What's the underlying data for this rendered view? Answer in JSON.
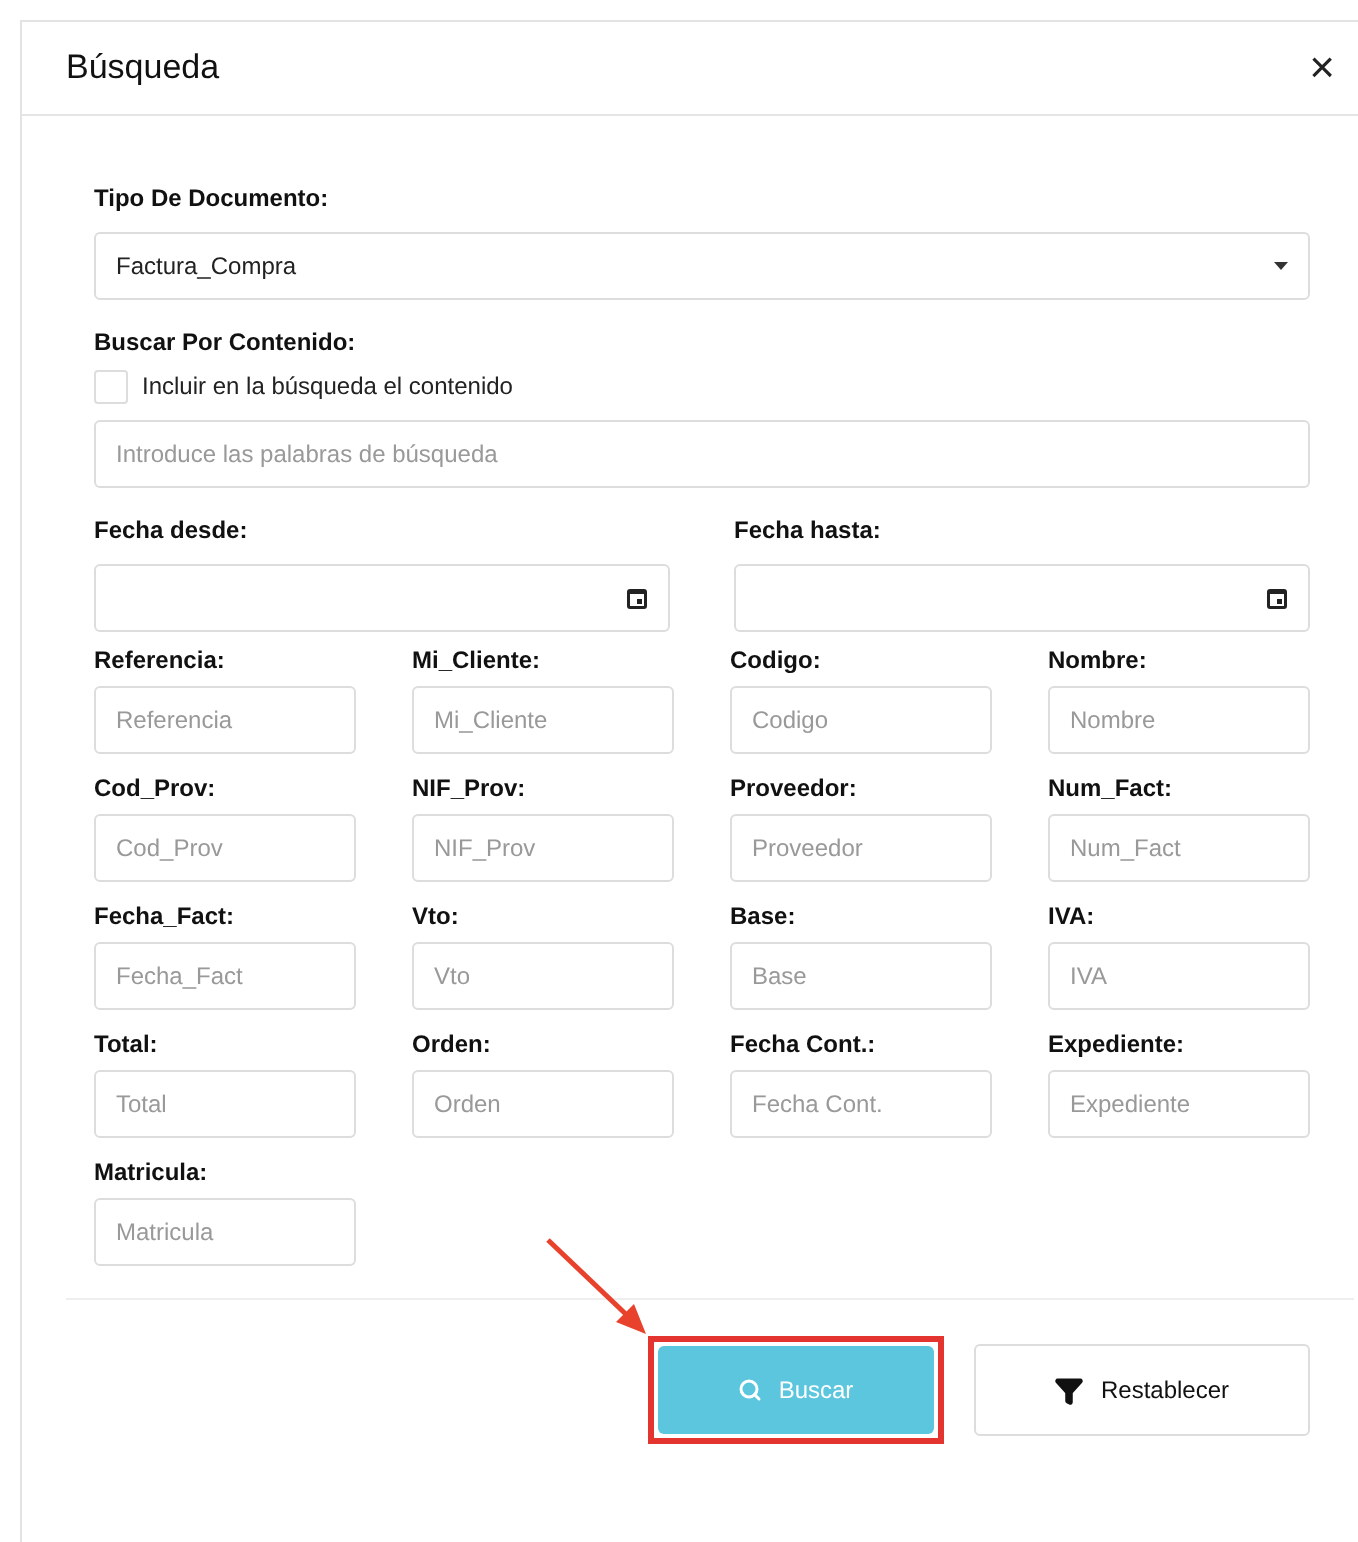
{
  "dialog": {
    "title": "Búsqueda",
    "close": "×"
  },
  "document_type": {
    "label": "Tipo De Documento:",
    "value": "Factura_Compra"
  },
  "content_search": {
    "label": "Buscar Por Contenido:",
    "checkbox": {
      "label": "Incluir en la búsqueda el contenido",
      "checked": false
    },
    "placeholder": "Introduce las palabras de búsqueda"
  },
  "dates": [
    {
      "label": "Fecha desde:"
    },
    {
      "label": "Fecha hasta:"
    }
  ],
  "fields": [
    {
      "label": "Referencia:",
      "placeholder": "Referencia"
    },
    {
      "label": "Mi_Cliente:",
      "placeholder": "Mi_Cliente"
    },
    {
      "label": "Codigo:",
      "placeholder": "Codigo"
    },
    {
      "label": "Nombre:",
      "placeholder": "Nombre"
    },
    {
      "label": "Cod_Prov:",
      "placeholder": "Cod_Prov"
    },
    {
      "label": "NIF_Prov:",
      "placeholder": "NIF_Prov"
    },
    {
      "label": "Proveedor:",
      "placeholder": "Proveedor"
    },
    {
      "label": "Num_Fact:",
      "placeholder": "Num_Fact"
    },
    {
      "label": "Fecha_Fact:",
      "placeholder": "Fecha_Fact"
    },
    {
      "label": "Vto:",
      "placeholder": "Vto"
    },
    {
      "label": "Base:",
      "placeholder": "Base"
    },
    {
      "label": "IVA:",
      "placeholder": "IVA"
    },
    {
      "label": "Total:",
      "placeholder": "Total"
    },
    {
      "label": "Orden:",
      "placeholder": "Orden"
    },
    {
      "label": "Fecha Cont.:",
      "placeholder": "Fecha Cont."
    },
    {
      "label": "Expediente:",
      "placeholder": "Expediente"
    },
    {
      "label": "Matricula:",
      "placeholder": "Matricula"
    }
  ],
  "buttons": [
    {
      "label": "Buscar",
      "kind": "primary",
      "highlighted": true
    },
    {
      "label": "Restablecer",
      "kind": "secondary",
      "highlighted": false
    }
  ]
}
